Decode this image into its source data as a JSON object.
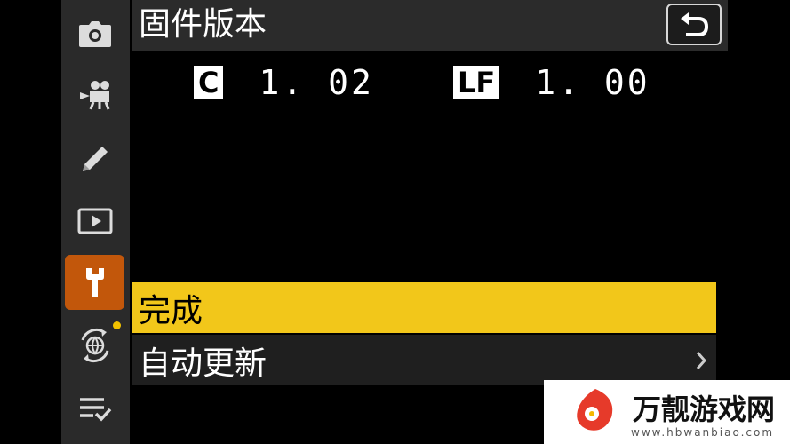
{
  "header": {
    "title": "固件版本"
  },
  "versions": [
    {
      "badge": "C",
      "value": "1. 02"
    },
    {
      "badge": "LF",
      "value": "1. 00"
    }
  ],
  "menu": {
    "items": [
      {
        "label": "完成",
        "selected": true
      },
      {
        "label": "自动更新",
        "selected": false,
        "has_submenu": true
      }
    ]
  },
  "sidebar": {
    "items": [
      {
        "icon": "camera-icon"
      },
      {
        "icon": "movie-camera-icon"
      },
      {
        "icon": "pencil-icon"
      },
      {
        "icon": "playback-icon"
      },
      {
        "icon": "wrench-icon",
        "active": true
      },
      {
        "icon": "network-icon"
      },
      {
        "icon": "my-menu-icon"
      }
    ]
  },
  "watermark": {
    "text": "万靓游戏网",
    "sub": "www.hbwanbiao.com"
  },
  "colors": {
    "accent": "#f2c71a",
    "active_tab": "#c2570b",
    "notification_dot": "#f2c200"
  }
}
